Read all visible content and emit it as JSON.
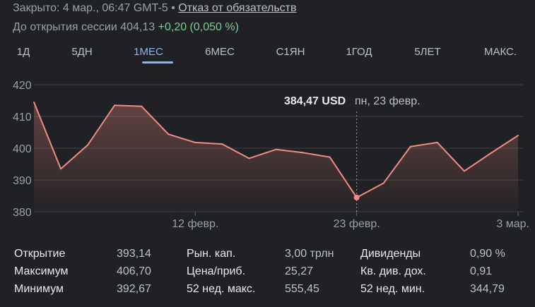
{
  "status": {
    "closed_text": "Закрыто: 4 мар., 06:47 GMT-5",
    "separator": "•",
    "disclaimer_link": "Отказ от обязательств"
  },
  "premarket": {
    "label": "До открытия сессии 404,13",
    "change": "+0,20 (0,050 %)",
    "change_color": "#81c995"
  },
  "tabs": [
    {
      "label": "1Д",
      "active": false
    },
    {
      "label": "5ДН",
      "active": false
    },
    {
      "label": "1МЕС",
      "active": true
    },
    {
      "label": "6МЕС",
      "active": false
    },
    {
      "label": "С1ЯН",
      "active": false
    },
    {
      "label": "1ГОД",
      "active": false
    },
    {
      "label": "5ЛЕТ",
      "active": false
    },
    {
      "label": "МАКС.",
      "active": false
    }
  ],
  "chart_data": {
    "type": "area",
    "y_ticks": [
      "420",
      "410",
      "400",
      "390",
      "380"
    ],
    "ylim": [
      380,
      420
    ],
    "x_tick_labels": [
      "12 февр.",
      "23 февр.",
      "3 мар."
    ],
    "values": [
      414.5,
      393.5,
      401,
      413.5,
      413.2,
      404.4,
      401.8,
      401.3,
      396.8,
      399.6,
      398.6,
      397.2,
      384.47,
      389,
      400.5,
      401.8,
      392.8,
      398.5,
      404
    ],
    "highlight_index": 12,
    "tooltip": {
      "price": "384,47 USD",
      "date": "пн, 23 февр."
    },
    "line_color": "#f28b82",
    "grid": true
  },
  "stats": {
    "columns": [
      {
        "rows": [
          {
            "label": "Открытие",
            "value": "393,14"
          },
          {
            "label": "Максимум",
            "value": "406,70"
          },
          {
            "label": "Минимум",
            "value": "392,67"
          }
        ]
      },
      {
        "rows": [
          {
            "label": "Рын. кап.",
            "value": "3,00 трлн"
          },
          {
            "label": "Цена/приб.",
            "value": "25,27"
          },
          {
            "label": "52 нед. макс.",
            "value": "555,45"
          }
        ]
      },
      {
        "rows": [
          {
            "label": "Дивиденды",
            "value": "0,90 %"
          },
          {
            "label": "Кв. див. дох.",
            "value": "0,91"
          },
          {
            "label": "52 нед. мин.",
            "value": "344,79"
          }
        ]
      }
    ]
  }
}
